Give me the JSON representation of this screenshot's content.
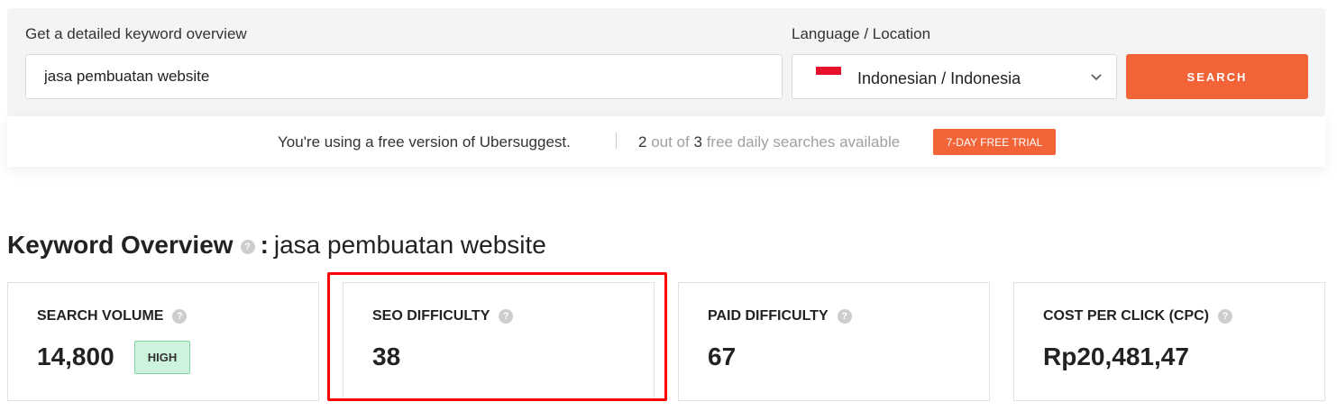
{
  "search": {
    "keyword_label": "Get a detailed keyword overview",
    "keyword_value": "jasa pembuatan website",
    "language_label": "Language / Location",
    "language_value": "Indonesian / Indonesia",
    "button_label": "SEARCH"
  },
  "banner": {
    "free_text": "You're using a free version of Ubersuggest.",
    "used_count": "2",
    "out_of_text": "out of",
    "total_count": "3",
    "available_text": "free daily searches available",
    "trial_button": "7-DAY FREE TRIAL"
  },
  "overview": {
    "title": "Keyword Overview",
    "separator": ":",
    "keyword": "jasa pembuatan website"
  },
  "metrics": {
    "search_volume": {
      "label": "SEARCH VOLUME",
      "value": "14,800",
      "badge": "HIGH"
    },
    "seo_difficulty": {
      "label": "SEO DIFFICULTY",
      "value": "38"
    },
    "paid_difficulty": {
      "label": "PAID DIFFICULTY",
      "value": "67"
    },
    "cpc": {
      "label": "COST PER CLICK (CPC)",
      "value": "Rp20,481,47"
    }
  },
  "icons": {
    "help": "?",
    "flag": "indonesia-flag-icon",
    "chevron": "chevron-down-icon"
  },
  "colors": {
    "accent": "#f26338",
    "highlight": "#ff0000",
    "badge_bg": "#cdf3dd",
    "badge_border": "#7ed6a3"
  }
}
